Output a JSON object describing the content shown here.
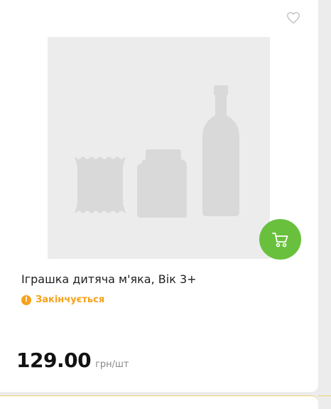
{
  "product": {
    "title": "Іграшка дитяча м'яка, Вік 3+",
    "status": "Закінчується",
    "price": "129.00",
    "unit": "грн/шт"
  },
  "icons": {
    "favorite": "heart-outline-icon",
    "cart": "shopping-cart-icon",
    "status": "exclamation-circle-icon",
    "placeholder": "product-placeholder-icon"
  },
  "colors": {
    "accent_green": "#69c03d",
    "status_orange": "#f6a21b",
    "placeholder_bg": "#ececec",
    "placeholder_shape": "#d9d9d9"
  }
}
